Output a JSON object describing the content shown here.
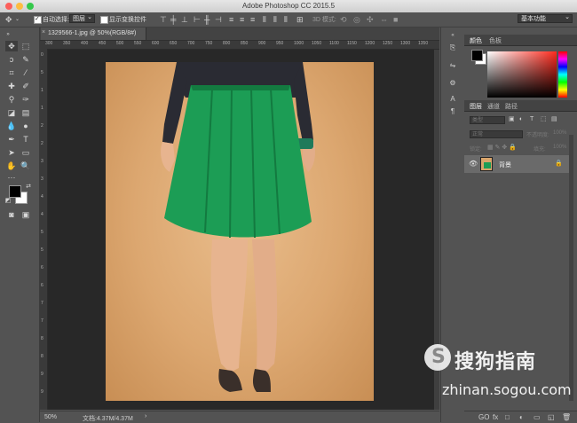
{
  "window": {
    "title": "Adobe Photoshop CC 2015.5",
    "traffic_colors": [
      "#fc605c",
      "#fdbc40",
      "#34c84a"
    ]
  },
  "options_bar": {
    "move_tool_icon": "move-icon",
    "auto_select_label": "自动选择:",
    "auto_select_checked": true,
    "auto_select_target": "图层",
    "show_transform_label": "显示变换控件",
    "show_transform_checked": false,
    "mode_3d_label": "3D 模式:",
    "workspace": "基本功能"
  },
  "document_tab": {
    "title": "1329566-1.jpg @ 50%(RGB/8#)",
    "close_glyph": "×"
  },
  "rulers": {
    "top_labels": [
      "300",
      "350",
      "400",
      "450",
      "500",
      "550",
      "600",
      "650",
      "700",
      "750",
      "800",
      "850",
      "900",
      "950",
      "1000",
      "1050",
      "1100",
      "1150",
      "1200",
      "1250",
      "1300",
      "1350"
    ],
    "left_labels": [
      "0",
      "5",
      "1",
      "1",
      "2",
      "2",
      "3",
      "3",
      "4",
      "4",
      "5",
      "5",
      "6",
      "6",
      "7",
      "7",
      "8",
      "8",
      "9",
      "9"
    ]
  },
  "status_bar": {
    "zoom": "50%",
    "doc_info": "文档:4.37M/4.37M",
    "arrow": "›"
  },
  "color_panel": {
    "tabs": [
      "颜色",
      "色板"
    ],
    "foreground": "#000000",
    "background": "#ffffff",
    "hue_color": "#ff2b1e"
  },
  "layers_panel": {
    "tabs": [
      "图层",
      "通道",
      "路径"
    ],
    "filter_kind": "类型",
    "blend_mode": "正常",
    "opacity_label": "不透明度:",
    "opacity_value": "100%",
    "lock_label": "锁定:",
    "fill_label": "填充:",
    "fill_value": "100%",
    "layer_name": "背景",
    "bottom_icons": [
      "GO",
      "fx",
      "□",
      "◐",
      "▭",
      "◱",
      "🗑"
    ]
  },
  "watermark": {
    "brand": "搜狗指南",
    "url": "zhinan.sogou.com"
  }
}
